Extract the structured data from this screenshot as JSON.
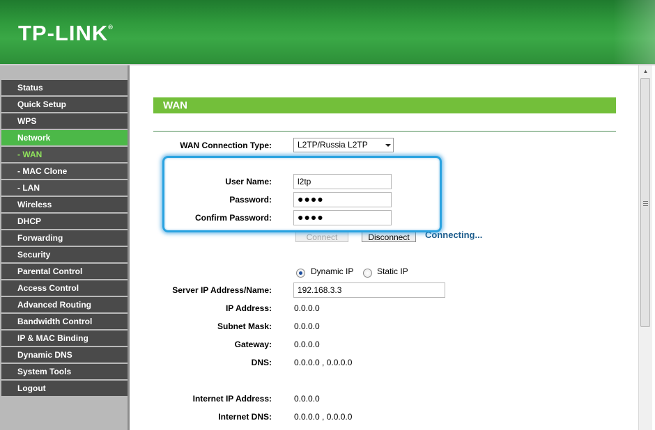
{
  "brand": {
    "logo_text": "TP-LINK",
    "registered_mark": "®"
  },
  "colors": {
    "header_green": "#2f9a3c",
    "active_menu": "#4cb848",
    "title_bar": "#73bf3a",
    "highlight": "#2aa3e0",
    "connecting_text": "#1c5c8c"
  },
  "sidebar": {
    "items": [
      {
        "label": "Status"
      },
      {
        "label": "Quick Setup"
      },
      {
        "label": "WPS"
      },
      {
        "label": "Network"
      },
      {
        "label": "- WAN"
      },
      {
        "label": "- MAC Clone"
      },
      {
        "label": "- LAN"
      },
      {
        "label": "Wireless"
      },
      {
        "label": "DHCP"
      },
      {
        "label": "Forwarding"
      },
      {
        "label": "Security"
      },
      {
        "label": "Parental Control"
      },
      {
        "label": "Access Control"
      },
      {
        "label": "Advanced Routing"
      },
      {
        "label": "Bandwidth Control"
      },
      {
        "label": "IP & MAC Binding"
      },
      {
        "label": "Dynamic DNS"
      },
      {
        "label": "System Tools"
      },
      {
        "label": "Logout"
      }
    ]
  },
  "page": {
    "title": "WAN",
    "wan_type_label": "WAN Connection Type:",
    "wan_type_value": "L2TP/Russia L2TP",
    "username_label": "User Name:",
    "username_value": "l2tp",
    "password_label": "Password:",
    "password_value": "●●●●",
    "confirm_label": "Confirm Password:",
    "confirm_value": "●●●●",
    "connect_label": "Connect",
    "disconnect_label": "Disconnect",
    "status_text": "Connecting...",
    "dynamic_ip_label": "Dynamic IP",
    "static_ip_label": "Static IP",
    "server_label": "Server IP Address/Name:",
    "server_value": "192.168.3.3",
    "ip_label": "IP Address:",
    "ip_value": "0.0.0.0",
    "mask_label": "Subnet Mask:",
    "mask_value": "0.0.0.0",
    "gateway_label": "Gateway:",
    "gateway_value": "0.0.0.0",
    "dns_label": "DNS:",
    "dns_value": "0.0.0.0 , 0.0.0.0",
    "inet_ip_label": "Internet IP Address:",
    "inet_ip_value": "0.0.0.0",
    "inet_dns_label": "Internet DNS:",
    "inet_dns_value": "0.0.0.0 , 0.0.0.0"
  }
}
